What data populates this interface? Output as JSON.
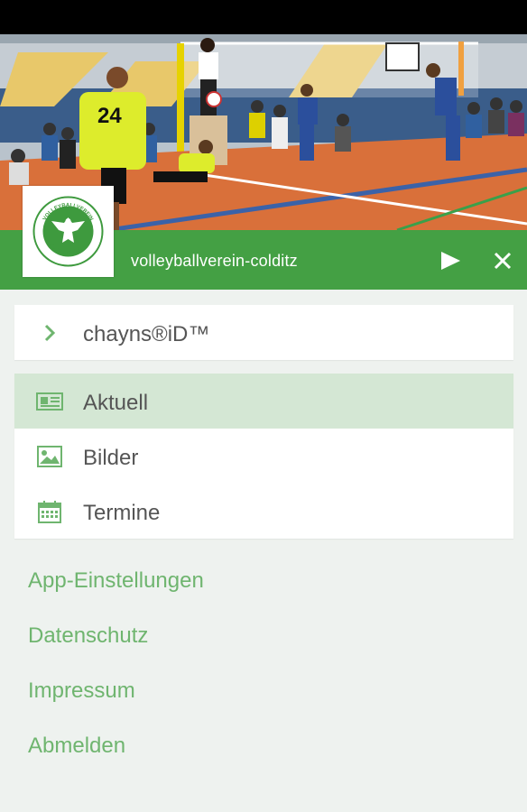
{
  "header": {
    "site_name": "volleyballverein-colditz",
    "play_icon": "play-icon",
    "close_icon": "close-icon",
    "logo_text_top": "VOLLEYBALLVEREIN",
    "logo_text_bottom": "SV COLDITZ E.V.",
    "accent": "#44a044"
  },
  "hero": {
    "jersey_number": "24"
  },
  "account": {
    "label": "chayns®iD™",
    "icon": "chevron-right-icon"
  },
  "menu": {
    "items": [
      {
        "label": "Aktuell",
        "icon": "newspaper-icon",
        "active": true
      },
      {
        "label": "Bilder",
        "icon": "image-icon",
        "active": false
      },
      {
        "label": "Termine",
        "icon": "calendar-icon",
        "active": false
      }
    ]
  },
  "links": {
    "items": [
      {
        "label": "App-Einstellungen"
      },
      {
        "label": "Datenschutz"
      },
      {
        "label": "Impressum"
      },
      {
        "label": "Abmelden"
      }
    ]
  }
}
